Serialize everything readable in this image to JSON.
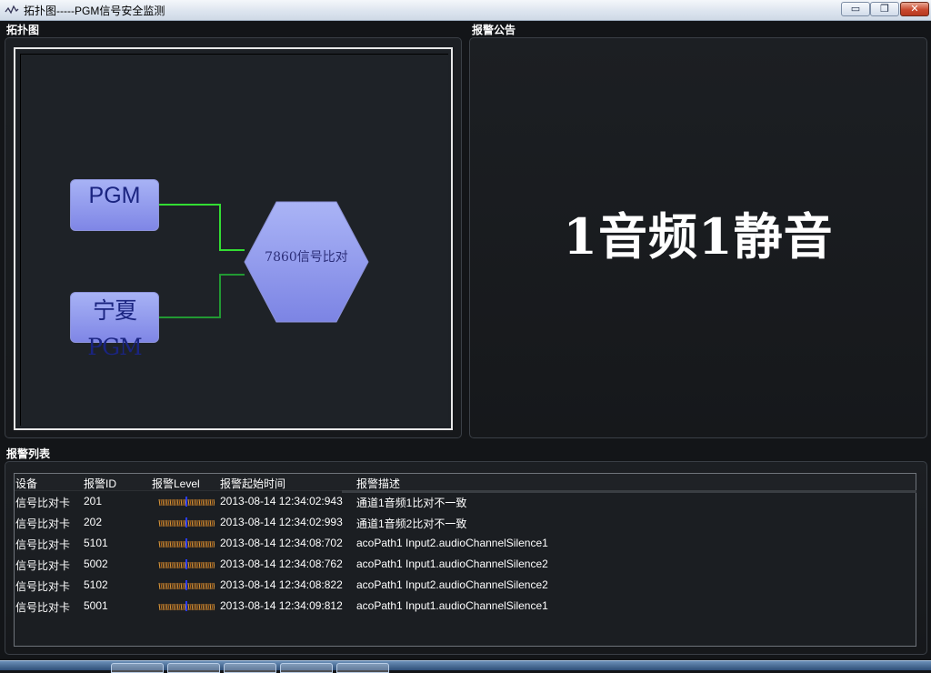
{
  "window": {
    "title": "拓扑图-----PGM信号安全监测",
    "min_glyph": "▭",
    "max_glyph": "❐",
    "close_glyph": "✕"
  },
  "topology": {
    "label": "拓扑图",
    "nodes": {
      "pgm": "PGM",
      "ningxia_pgm": "宁夏PGM",
      "comparator": "7860信号比对"
    },
    "colors": {
      "link_active": "#33dd33",
      "link_normal": "#229933",
      "node_fill": "#8f97ee"
    }
  },
  "alarm_notice": {
    "label": "报警公告",
    "message": "1音频1静音"
  },
  "alarm_list": {
    "label": "报警列表",
    "columns": [
      "设备",
      "报警ID",
      "报警Level",
      "报警起始时间",
      "报警描述"
    ],
    "rows": [
      {
        "device": "信号比对卡",
        "id": "201",
        "time": "2013-08-14 12:34:02:943",
        "desc": "通道1音频1比对不一致"
      },
      {
        "device": "信号比对卡",
        "id": "202",
        "time": "2013-08-14 12:34:02:993",
        "desc": "通道1音频2比对不一致"
      },
      {
        "device": "信号比对卡",
        "id": "5101",
        "time": "2013-08-14 12:34:08:702",
        "desc": "acoPath1 Input2.audioChannelSilence1"
      },
      {
        "device": "信号比对卡",
        "id": "5002",
        "time": "2013-08-14 12:34:08:762",
        "desc": "acoPath1 Input1.audioChannelSilence2"
      },
      {
        "device": "信号比对卡",
        "id": "5102",
        "time": "2013-08-14 12:34:08:822",
        "desc": "acoPath1 Input2.audioChannelSilence2"
      },
      {
        "device": "信号比对卡",
        "id": "5001",
        "time": "2013-08-14 12:34:09:812",
        "desc": "acoPath1 Input1.audioChannelSilence1"
      }
    ]
  }
}
